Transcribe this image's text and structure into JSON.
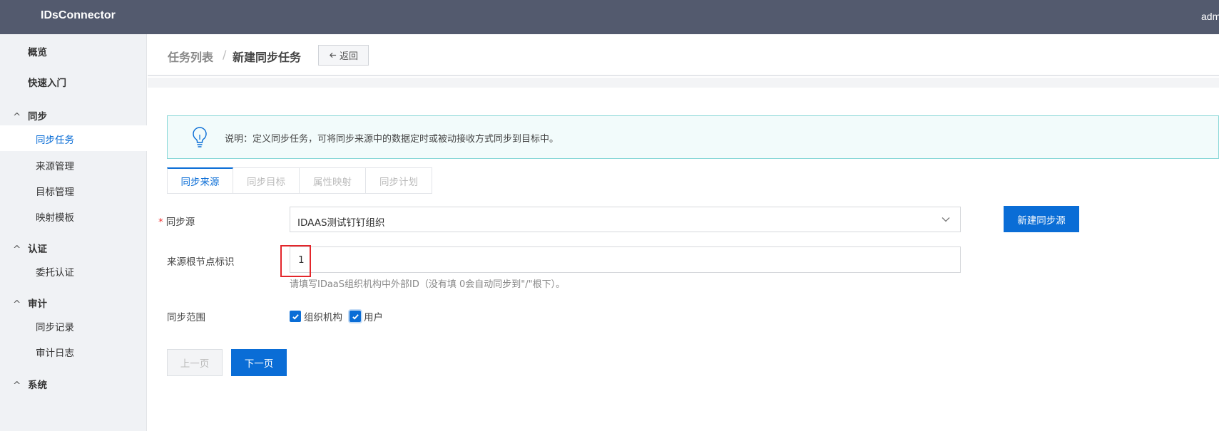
{
  "app": {
    "title": "IDsConnector",
    "user": "admin"
  },
  "sidebar": {
    "items": [
      {
        "label": "概览"
      },
      {
        "label": "快速入门"
      }
    ],
    "groups": [
      {
        "label": "同步",
        "items": [
          "同步任务",
          "来源管理",
          "目标管理",
          "映射模板"
        ]
      },
      {
        "label": "认证",
        "items": [
          "委托认证"
        ]
      },
      {
        "label": "审计",
        "items": [
          "同步记录",
          "审计日志"
        ]
      },
      {
        "label": "系统",
        "items": []
      }
    ],
    "active": "同步任务"
  },
  "breadcrumb": {
    "parent": "任务列表",
    "separator": "/",
    "current": "新建同步任务"
  },
  "back_button": {
    "label": "返回",
    "icon": "arrow-left-icon"
  },
  "notice": {
    "icon": "lightbulb-icon",
    "text": "说明：定义同步任务，可将同步来源中的数据定时或被动接收方式同步到目标中。"
  },
  "tabs": [
    {
      "label": "同步来源",
      "active": true
    },
    {
      "label": "同步目标",
      "active": false
    },
    {
      "label": "属性映射",
      "active": false
    },
    {
      "label": "同步计划",
      "active": false
    }
  ],
  "form": {
    "source": {
      "label": "同步源",
      "required": true,
      "value": "IDAAS测试钉钉组织",
      "button": "新建同步源"
    },
    "root_node": {
      "label": "来源根节点标识",
      "value": "1",
      "hint": "请填写IDaaS组织机构中外部ID（没有填 0会自动同步到\"/\"根下）。"
    },
    "scope": {
      "label": "同步范围",
      "options": [
        {
          "label": "组织机构",
          "checked": true
        },
        {
          "label": "用户",
          "checked": true
        }
      ]
    }
  },
  "footer": {
    "prev": "上一页",
    "next": "下一页"
  },
  "colors": {
    "primary": "#0a6dd6",
    "header": "#535a6e",
    "highlight": "#e3262b"
  }
}
